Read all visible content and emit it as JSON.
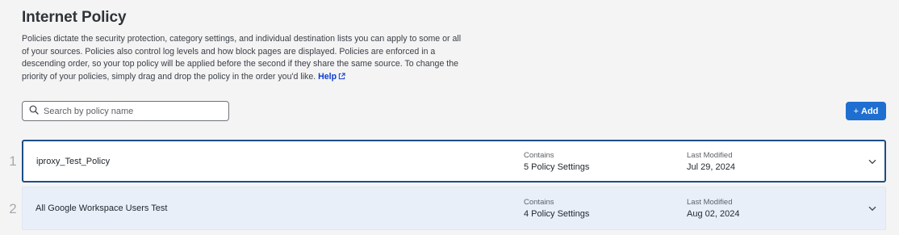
{
  "header": {
    "title": "Internet Policy",
    "description": "Policies dictate the security protection, category settings, and individual destination lists you can apply to some or all of your sources. Policies also control log levels and how block pages are displayed. Policies are enforced in a descending order, so your top policy will be applied before the second if they share the same source. To change the priority of your policies, simply drag and drop the policy in the order you'd like.",
    "help_label": "Help"
  },
  "search": {
    "placeholder": "Search by policy name",
    "value": ""
  },
  "toolbar": {
    "add_plus": "+",
    "add_label": "Add"
  },
  "columns": {
    "contains": "Contains",
    "last_modified": "Last Modified"
  },
  "policies": [
    {
      "index": "1",
      "name": "iproxy_Test_Policy",
      "contains": "5 Policy Settings",
      "last_modified": "Jul 29, 2024"
    },
    {
      "index": "2",
      "name": "All Google Workspace Users Test",
      "contains": "4 Policy Settings",
      "last_modified": "Aug 02, 2024"
    }
  ],
  "colors": {
    "accent": "#1f6fd1",
    "selected_border": "#1d4e86",
    "alt_row_bg": "#e8eff9",
    "link": "#0d3ccf"
  },
  "icons": [
    "search-icon",
    "external-link-icon",
    "chevron-down-icon"
  ]
}
